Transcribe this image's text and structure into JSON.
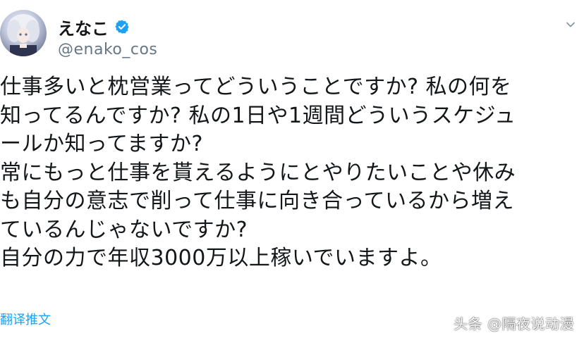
{
  "tweet": {
    "display_name": "えなこ",
    "handle": "@enako_cos",
    "verified": true,
    "verified_color": "#1da1f2",
    "lines": [
      "仕事多いと枕営業ってどういうことですか? 私の何を",
      "知ってるんですか? 私の1日や1週間どういうスケジュ",
      "ールか知ってますか?",
      "常にもっと仕事を貰えるようにとやりたいことや休み",
      "も自分の意志で削って仕事に向き合っているから増え",
      "ているんじゃないですか?",
      "自分の力で年収3000万以上稼いでいますよ。"
    ],
    "translate_label": "翻译推文"
  },
  "watermark": {
    "text": "头条 @隔夜说动漫"
  },
  "icons": {
    "verified": "verified-badge-icon",
    "caret": "chevron-down-icon"
  }
}
